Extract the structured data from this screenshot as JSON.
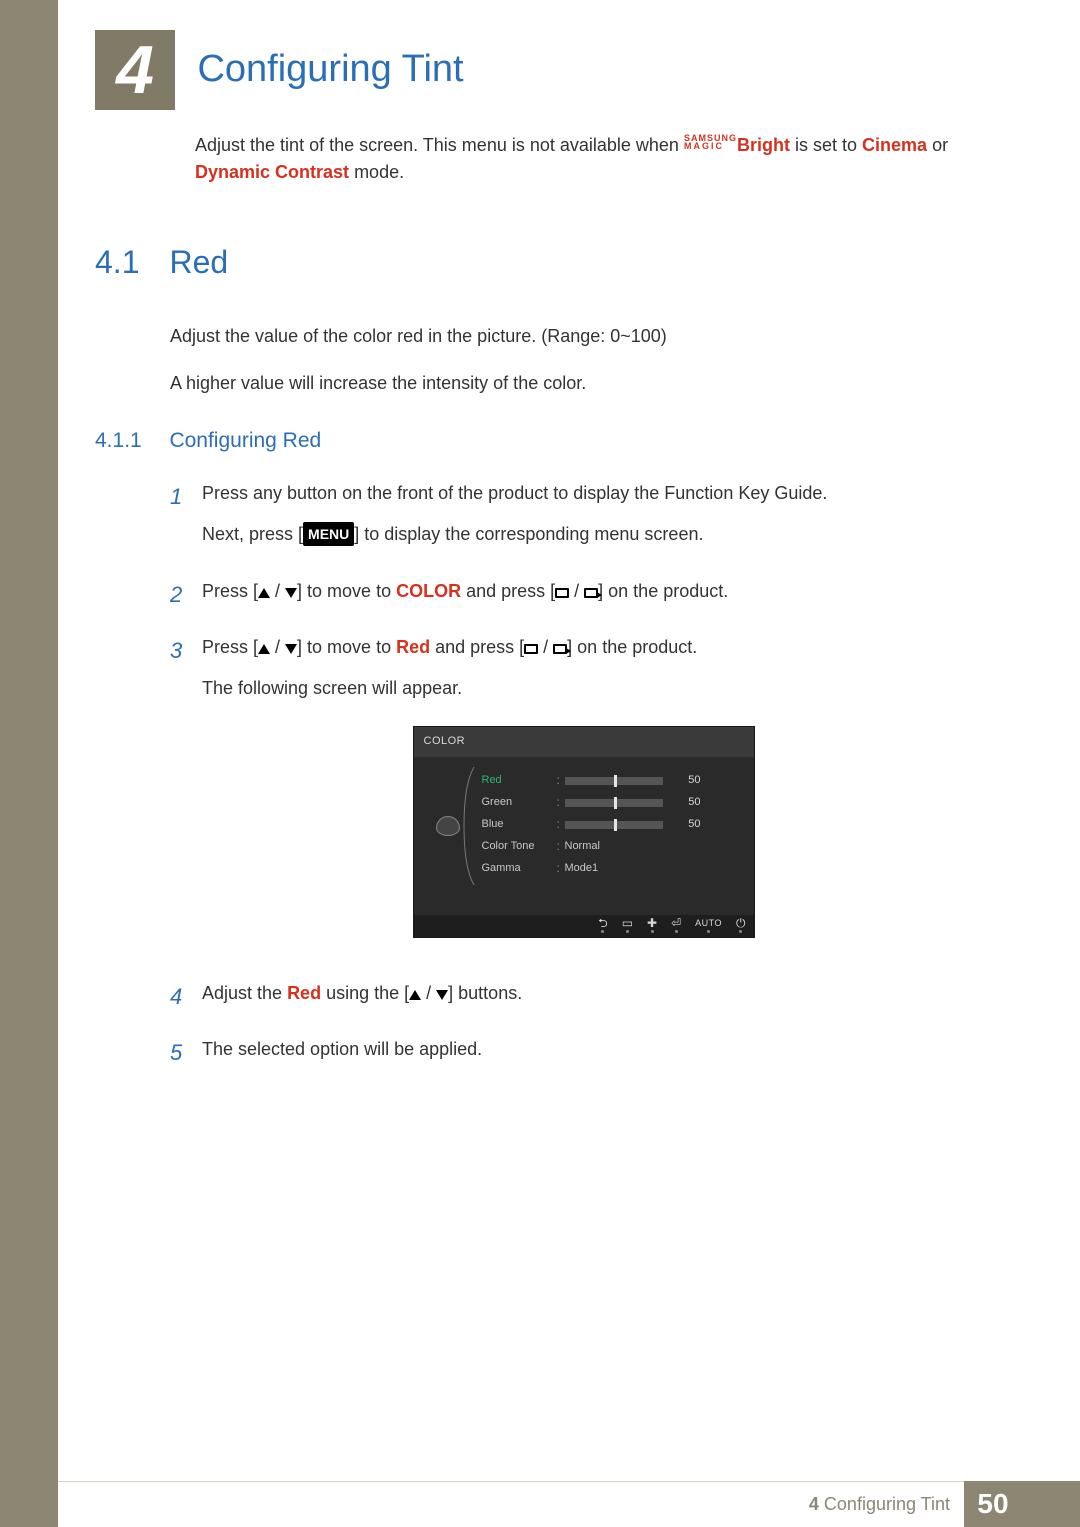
{
  "chapter": {
    "number": "4",
    "title": "Configuring Tint"
  },
  "intro": {
    "part1": "Adjust the tint of the screen. This menu is not available when ",
    "magic_top": "SAMSUNG",
    "magic_bot": "MAGIC",
    "bright": "Bright",
    "part2": " is set to ",
    "cinema": "Cinema",
    "part3": " or ",
    "dc": "Dynamic Contrast",
    "part4": " mode."
  },
  "section": {
    "number": "4.1",
    "title": "Red"
  },
  "body": {
    "p1": "Adjust the value of the color red in the picture. (Range: 0~100)",
    "p2": "A higher value will increase the intensity of the color."
  },
  "subsection": {
    "number": "4.1.1",
    "title": "Configuring Red"
  },
  "steps": {
    "s1a": "Press any button on the front of the product to display the Function Key Guide.",
    "s1b_pre": "Next, press [",
    "s1b_menu": "MENU",
    "s1b_post": "] to display the corresponding menu screen.",
    "s2_pre": "Press [",
    "s2_mid": "] to move to ",
    "s2_color": "COLOR",
    "s2_post1": " and press [",
    "s2_post2": "] on the product.",
    "s3_pre": "Press [",
    "s3_mid": "] to move to ",
    "s3_red": "Red",
    "s3_post1": " and press [",
    "s3_post2": "] on the product.",
    "s3_p2": "The following screen will appear.",
    "s4_pre": "Adjust the ",
    "s4_red": "Red",
    "s4_mid": " using the [",
    "s4_post": "] buttons.",
    "s5": "The selected option will be applied."
  },
  "osd": {
    "title": "COLOR",
    "rows": {
      "red": {
        "label": "Red",
        "value": "50",
        "fill": 50
      },
      "green": {
        "label": "Green",
        "value": "50",
        "fill": 50
      },
      "blue": {
        "label": "Blue",
        "value": "50",
        "fill": 50
      },
      "colortone": {
        "label": "Color Tone",
        "value": "Normal"
      },
      "gamma": {
        "label": "Gamma",
        "value": "Mode1"
      }
    },
    "footer_auto": "AUTO"
  },
  "footer": {
    "chapter_num": "4",
    "chapter_title": "Configuring Tint",
    "page": "50"
  }
}
